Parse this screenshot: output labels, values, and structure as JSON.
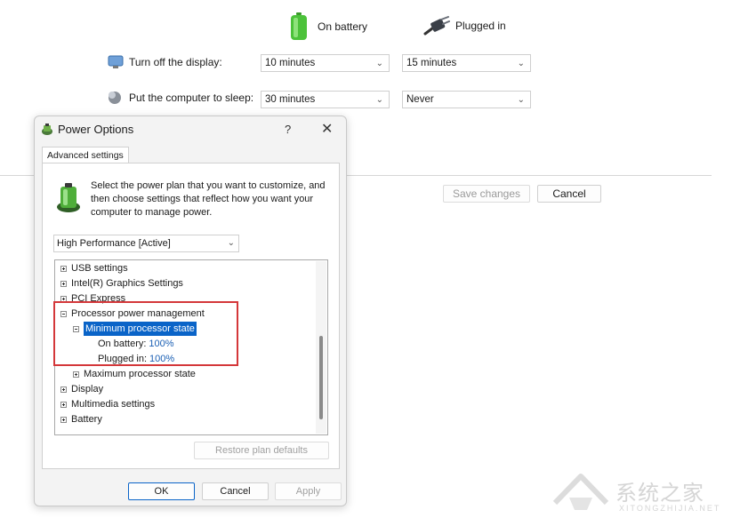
{
  "plan_settings": {
    "columns": {
      "on_battery": "On battery",
      "plugged_in": "Plugged in"
    },
    "rows": [
      {
        "label": "Turn off the display:",
        "on_battery": "10 minutes",
        "plugged_in": "15 minutes"
      },
      {
        "label": "Put the computer to sleep:",
        "on_battery": "30 minutes",
        "plugged_in": "Never"
      }
    ],
    "save_changes": "Save changes",
    "cancel": "Cancel"
  },
  "dialog": {
    "title": "Power Options",
    "help": "?",
    "close": "✕",
    "tab": "Advanced settings",
    "description": "Select the power plan that you want to customize, and then choose settings that reflect how you want your computer to manage power.",
    "plan_selected": "High Performance [Active]",
    "tree": [
      {
        "label": "USB settings"
      },
      {
        "label": "Intel(R) Graphics Settings"
      },
      {
        "label": "PCI Express"
      },
      {
        "label": "Processor power management"
      },
      {
        "label": "Minimum processor state"
      },
      {
        "label": "On battery:",
        "value": "100%"
      },
      {
        "label": "Plugged in:",
        "value": "100%"
      },
      {
        "label": "Maximum processor state"
      },
      {
        "label": "Display"
      },
      {
        "label": "Multimedia settings"
      },
      {
        "label": "Battery"
      }
    ],
    "restore": "Restore plan defaults",
    "ok": "OK",
    "cancel": "Cancel",
    "apply": "Apply"
  },
  "watermark": {
    "main": "系统之家",
    "sub": "XITONGZHIJIA.NET"
  },
  "colors": {
    "accent": "#0a64c8",
    "highlight_box": "#d4373a",
    "value_text": "#1a5fb4"
  }
}
